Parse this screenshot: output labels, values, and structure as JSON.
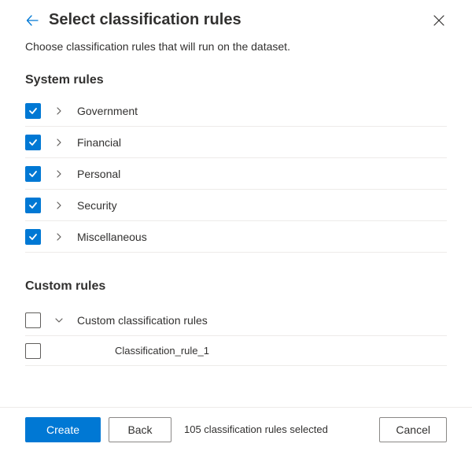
{
  "header": {
    "title": "Select classification rules",
    "subtitle": "Choose classification rules that will run on the dataset."
  },
  "sections": {
    "system": {
      "heading": "System rules",
      "rules": [
        {
          "label": "Government",
          "checked": true,
          "expanded": false
        },
        {
          "label": "Financial",
          "checked": true,
          "expanded": false
        },
        {
          "label": "Personal",
          "checked": true,
          "expanded": false
        },
        {
          "label": "Security",
          "checked": true,
          "expanded": false
        },
        {
          "label": "Miscellaneous",
          "checked": true,
          "expanded": false
        }
      ]
    },
    "custom": {
      "heading": "Custom rules",
      "group": {
        "label": "Custom classification rules",
        "checked": false,
        "expanded": true,
        "children": [
          {
            "label": "Classification_rule_1",
            "checked": false
          }
        ]
      }
    }
  },
  "footer": {
    "create_label": "Create",
    "back_label": "Back",
    "status": "105 classification rules selected",
    "cancel_label": "Cancel"
  }
}
